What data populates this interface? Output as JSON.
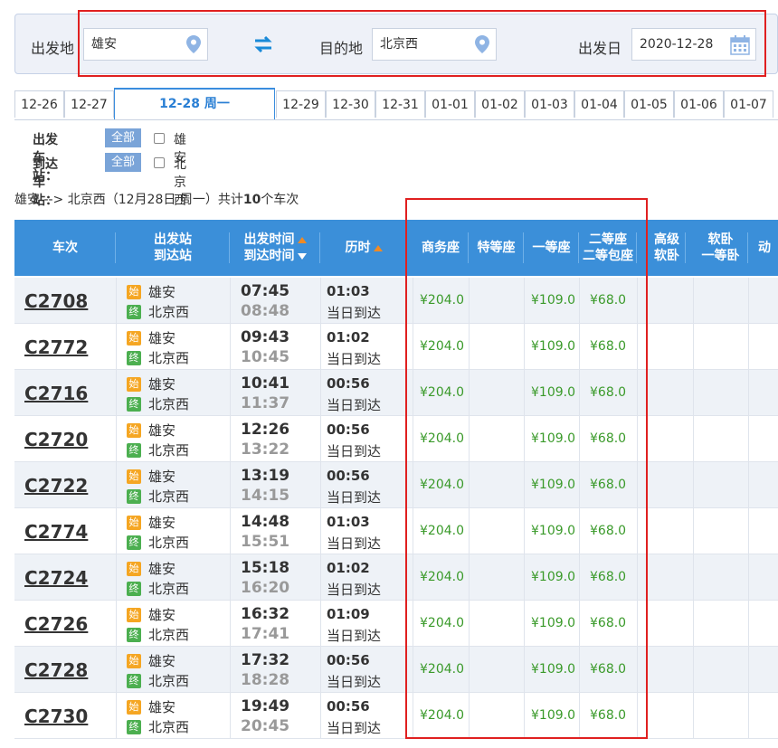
{
  "search": {
    "from_label": "出发地",
    "from_value": "雄安",
    "to_label": "目的地",
    "to_value": "北京西",
    "date_label": "出发日",
    "date_value": "2020-12-28"
  },
  "date_tabs": [
    "12-26",
    "12-27",
    "12-28 周一",
    "12-29",
    "12-30",
    "12-31",
    "01-01",
    "01-02",
    "01-03",
    "01-04",
    "01-05",
    "01-06",
    "01-07"
  ],
  "active_tab_index": 2,
  "filters": {
    "depart_label": "出发车站：",
    "depart_all": "全部",
    "depart_station": "雄安",
    "arrive_label": "到达车站：",
    "arrive_all": "全部",
    "arrive_station": "北京西"
  },
  "summary": {
    "prefix": "雄安 --> 北京西（12月28日  周一）共计",
    "count": "10",
    "suffix": "个车次"
  },
  "columns": {
    "train": "车次",
    "station1": "出发站",
    "station2": "到达站",
    "time1": "出发时间",
    "time2": "到达时间",
    "duration": "历时",
    "business": "商务座",
    "premium": "特等座",
    "first": "一等座",
    "second1": "二等座",
    "second2": "二等包座",
    "highsoft1": "高级",
    "highsoft2": "软卧",
    "softfirst1": "软卧",
    "softfirst2": "一等卧",
    "more": "动"
  },
  "tags": {
    "start": "始",
    "end": "终"
  },
  "trains": [
    {
      "no": "C2708",
      "from": "雄安",
      "to": "北京西",
      "dep": "07:45",
      "arr": "08:48",
      "dur": "01:03",
      "day": "当日到达",
      "business": "¥204.0",
      "first": "¥109.0",
      "second": "¥68.0"
    },
    {
      "no": "C2772",
      "from": "雄安",
      "to": "北京西",
      "dep": "09:43",
      "arr": "10:45",
      "dur": "01:02",
      "day": "当日到达",
      "business": "¥204.0",
      "first": "¥109.0",
      "second": "¥68.0"
    },
    {
      "no": "C2716",
      "from": "雄安",
      "to": "北京西",
      "dep": "10:41",
      "arr": "11:37",
      "dur": "00:56",
      "day": "当日到达",
      "business": "¥204.0",
      "first": "¥109.0",
      "second": "¥68.0"
    },
    {
      "no": "C2720",
      "from": "雄安",
      "to": "北京西",
      "dep": "12:26",
      "arr": "13:22",
      "dur": "00:56",
      "day": "当日到达",
      "business": "¥204.0",
      "first": "¥109.0",
      "second": "¥68.0"
    },
    {
      "no": "C2722",
      "from": "雄安",
      "to": "北京西",
      "dep": "13:19",
      "arr": "14:15",
      "dur": "00:56",
      "day": "当日到达",
      "business": "¥204.0",
      "first": "¥109.0",
      "second": "¥68.0"
    },
    {
      "no": "C2774",
      "from": "雄安",
      "to": "北京西",
      "dep": "14:48",
      "arr": "15:51",
      "dur": "01:03",
      "day": "当日到达",
      "business": "¥204.0",
      "first": "¥109.0",
      "second": "¥68.0"
    },
    {
      "no": "C2724",
      "from": "雄安",
      "to": "北京西",
      "dep": "15:18",
      "arr": "16:20",
      "dur": "01:02",
      "day": "当日到达",
      "business": "¥204.0",
      "first": "¥109.0",
      "second": "¥68.0"
    },
    {
      "no": "C2726",
      "from": "雄安",
      "to": "北京西",
      "dep": "16:32",
      "arr": "17:41",
      "dur": "01:09",
      "day": "当日到达",
      "business": "¥204.0",
      "first": "¥109.0",
      "second": "¥68.0"
    },
    {
      "no": "C2728",
      "from": "雄安",
      "to": "北京西",
      "dep": "17:32",
      "arr": "18:28",
      "dur": "00:56",
      "day": "当日到达",
      "business": "¥204.0",
      "first": "¥109.0",
      "second": "¥68.0"
    },
    {
      "no": "C2730",
      "from": "雄安",
      "to": "北京西",
      "dep": "19:49",
      "arr": "20:45",
      "dur": "00:56",
      "day": "当日到达",
      "business": "¥204.0",
      "first": "¥109.0",
      "second": "¥68.0"
    }
  ],
  "colors": {
    "header_bg": "#3b8fd9",
    "price": "#3a9a2a",
    "highlight": "#e02020",
    "active_tab": "#2a7fd4"
  }
}
